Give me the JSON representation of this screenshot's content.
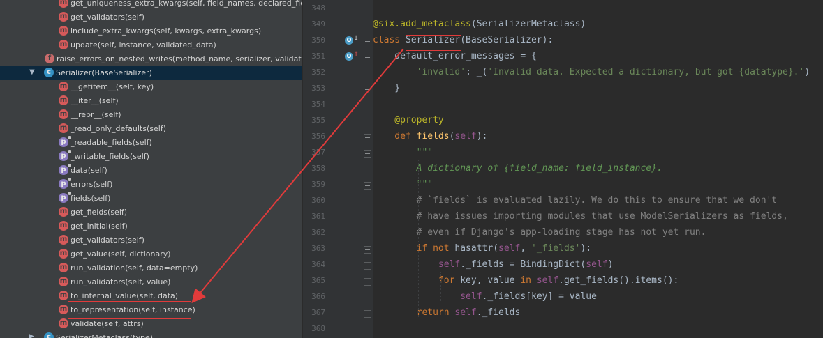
{
  "structure": {
    "rows": [
      {
        "icon": "m",
        "label": "get_uniqueness_extra_kwargs(self, field_names, declared_fields, extra"
      },
      {
        "icon": "m",
        "label": "get_validators(self)"
      },
      {
        "icon": "m",
        "label": "include_extra_kwargs(self, kwargs, extra_kwargs)"
      },
      {
        "icon": "m",
        "label": "update(self, instance, validated_data)"
      },
      {
        "icon": "f",
        "label": "raise_errors_on_nested_writes(method_name, serializer, validated_data)"
      },
      {
        "icon": "c",
        "label": "Serializer(BaseSerializer)"
      },
      {
        "icon": "m",
        "label": "__getitem__(self, key)"
      },
      {
        "icon": "m",
        "label": "__iter__(self)"
      },
      {
        "icon": "m",
        "label": "__repr__(self)"
      },
      {
        "icon": "m",
        "label": "_read_only_defaults(self)"
      },
      {
        "icon": "p",
        "label": "_readable_fields(self)"
      },
      {
        "icon": "p",
        "label": "_writable_fields(self)"
      },
      {
        "icon": "p",
        "label": "data(self)"
      },
      {
        "icon": "p",
        "label": "errors(self)"
      },
      {
        "icon": "p",
        "label": "fields(self)"
      },
      {
        "icon": "m",
        "label": "get_fields(self)"
      },
      {
        "icon": "m",
        "label": "get_initial(self)"
      },
      {
        "icon": "m",
        "label": "get_validators(self)"
      },
      {
        "icon": "m",
        "label": "get_value(self, dictionary)"
      },
      {
        "icon": "m",
        "label": "run_validation(self, data=empty)"
      },
      {
        "icon": "m",
        "label": "run_validators(self, value)"
      },
      {
        "icon": "m",
        "label": "to_internal_value(self, data)"
      },
      {
        "icon": "m",
        "label": "to_representation(self, instance)"
      },
      {
        "icon": "m",
        "label": "validate(self, attrs)"
      },
      {
        "icon": "c",
        "label": "SerializerMetaclass(type)"
      }
    ],
    "icon_letters": {
      "m": "m",
      "f": "f",
      "c": "c",
      "p": "p"
    }
  },
  "editor": {
    "line_numbers": [
      "348",
      "349",
      "350",
      "351",
      "352",
      "353",
      "354",
      "355",
      "356",
      "357",
      "358",
      "359",
      "360",
      "361",
      "362",
      "363",
      "364",
      "365",
      "366",
      "367",
      "368"
    ],
    "gutter_marker": "O",
    "code_lines": [
      [],
      [
        [
          "dec",
          "@six.add_metaclass"
        ],
        [
          "",
          "(SerializerMetaclass)"
        ]
      ],
      [
        [
          "kw",
          "class "
        ],
        [
          "",
          "Serializer(BaseSerializer):"
        ]
      ],
      [
        [
          "",
          "    default_error_messages = {"
        ]
      ],
      [
        [
          "",
          "        "
        ],
        [
          "str",
          "'invalid'"
        ],
        [
          "",
          ": _("
        ],
        [
          "str",
          "'Invalid data. Expected a dictionary, but got {datatype}.'"
        ],
        [
          "",
          ")"
        ]
      ],
      [
        [
          "",
          "    }"
        ]
      ],
      [],
      [
        [
          "dec",
          "    @property"
        ]
      ],
      [
        [
          "kw",
          "    def "
        ],
        [
          "fn",
          "fields"
        ],
        [
          "",
          "("
        ],
        [
          "slf",
          "self"
        ],
        [
          "",
          "):"
        ]
      ],
      [
        [
          "doc",
          "        \"\"\""
        ]
      ],
      [
        [
          "doc",
          "        A dictionary of {field_name: field_instance}."
        ]
      ],
      [
        [
          "doc",
          "        \"\"\""
        ]
      ],
      [
        [
          "cmt",
          "        # `fields` is evaluated lazily. We do this to ensure that we don't"
        ]
      ],
      [
        [
          "cmt",
          "        # have issues importing modules that use ModelSerializers as fields,"
        ]
      ],
      [
        [
          "cmt",
          "        # even if Django's app-loading stage has not yet run."
        ]
      ],
      [
        [
          "kw",
          "        if not "
        ],
        [
          "",
          "hasattr("
        ],
        [
          "slf",
          "self"
        ],
        [
          "",
          ", "
        ],
        [
          "str",
          "'_fields'"
        ],
        [
          "",
          "):"
        ]
      ],
      [
        [
          "slf",
          "            self"
        ],
        [
          "",
          "._fields = BindingDict("
        ],
        [
          "slf",
          "self"
        ],
        [
          "",
          ")"
        ]
      ],
      [
        [
          "kw",
          "            for "
        ],
        [
          "",
          "key, value "
        ],
        [
          "kw",
          "in "
        ],
        [
          "slf",
          "self"
        ],
        [
          "",
          ".get_fields().items():"
        ]
      ],
      [
        [
          "slf",
          "                self"
        ],
        [
          "",
          "._fields[key] = value"
        ]
      ],
      [
        [
          "kw",
          "        return "
        ],
        [
          "slf",
          "self"
        ],
        [
          "",
          "._fields"
        ]
      ],
      []
    ]
  },
  "colors": {
    "annotation_red": "#e03b3b"
  }
}
